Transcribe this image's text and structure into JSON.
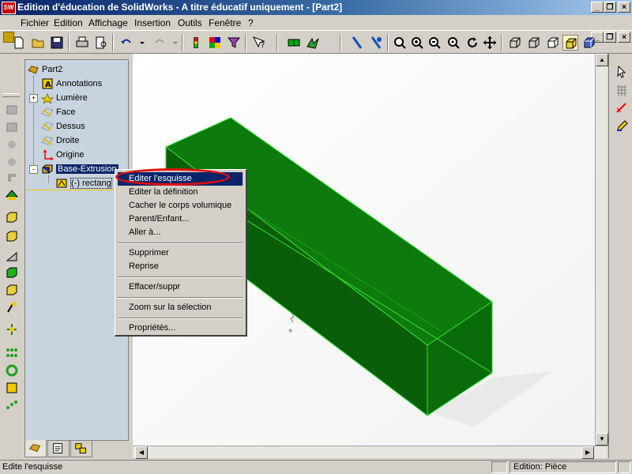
{
  "window": {
    "title": "Edition d'éducation de SolidWorks - A titre éducatif uniquement - [Part2]",
    "app_icon_text": "SW"
  },
  "menubar": {
    "items": [
      "Fichier",
      "Edition",
      "Affichage",
      "Insertion",
      "Outils",
      "Fenêtre",
      "?"
    ]
  },
  "toolbar": {
    "icons": [
      "new-document-icon",
      "open-folder-icon",
      "save-icon",
      "print-icon",
      "print-preview-icon",
      "undo-icon",
      "redo-icon",
      "rebuild-icon",
      "color-palette-icon",
      "selection-filter-icon",
      "whats-this-icon",
      "sketch-icon",
      "smart-dimension-icon",
      "measure-icon",
      "appearance-icon",
      "zoom-to-fit-icon",
      "zoom-in-out-icon",
      "zoom-window-icon",
      "rotate-view-icon",
      "pan-icon",
      "wireframe-icon",
      "hidden-lines-icon",
      "hidden-lines-removed-icon",
      "shaded-icon",
      "shaded-edges-icon"
    ]
  },
  "feature_tree": {
    "root": "Part2",
    "items": [
      {
        "label": "Annotations",
        "icon": "annotations-icon",
        "expander": ""
      },
      {
        "label": "Lumière",
        "icon": "light-icon",
        "expander": "+"
      },
      {
        "label": "Face",
        "icon": "plane-icon",
        "expander": ""
      },
      {
        "label": "Dessus",
        "icon": "plane-icon",
        "expander": ""
      },
      {
        "label": "Droite",
        "icon": "plane-icon",
        "expander": ""
      },
      {
        "label": "Origine",
        "icon": "origin-icon",
        "expander": ""
      },
      {
        "label": "Base-Extrusion",
        "icon": "extrude-icon",
        "expander": "-",
        "selected": true
      },
      {
        "label": "(-) rectang",
        "icon": "sketch-icon",
        "expander": ""
      }
    ]
  },
  "context_menu": {
    "groups": [
      [
        "Editer l'esquisse",
        "Editer la définition",
        "Cacher le corps volumique",
        "Parent/Enfant...",
        "Aller à..."
      ],
      [
        "Supprimer",
        "Reprise"
      ],
      [
        "Effacer/suppr"
      ],
      [
        "Zoom sur la sélection"
      ],
      [
        "Propriétés..."
      ]
    ],
    "highlighted": "Editer l'esquisse"
  },
  "status": {
    "message": "Edite l'esquisse",
    "mode": "Edition: Pièce"
  },
  "colors": {
    "model_fill": "#0a6b0a",
    "model_top": "#0c7a0c",
    "model_edge": "#33e033",
    "highlight_ring": "#e01010",
    "selection": "#0a246a"
  }
}
